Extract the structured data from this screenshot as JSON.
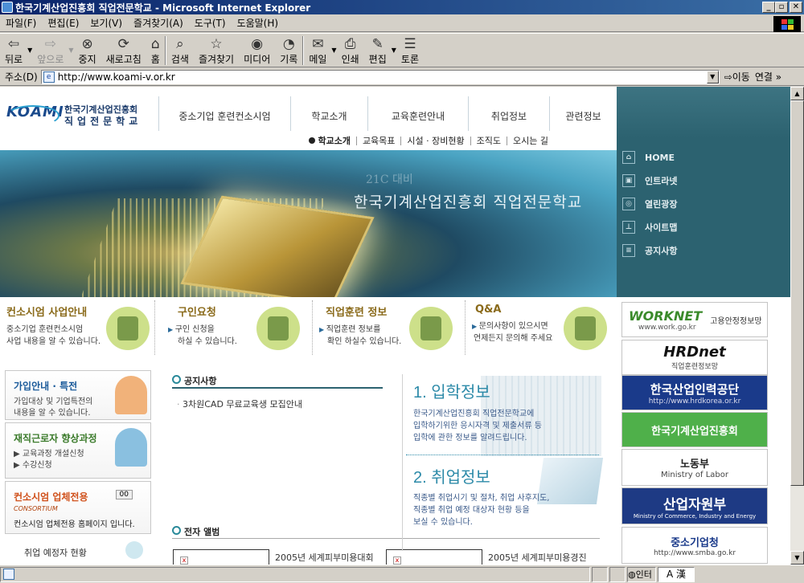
{
  "window": {
    "title": "한국기계산업진흥회 직업전문학교 - Microsoft Internet Explorer",
    "min": "_",
    "max": "▫",
    "close": "✕"
  },
  "menu": [
    "파일(F)",
    "편집(E)",
    "보기(V)",
    "즐겨찾기(A)",
    "도구(T)",
    "도움말(H)"
  ],
  "toolbar": {
    "back": "뒤로",
    "forward": "앞으로",
    "stop": "중지",
    "refresh": "새로고침",
    "home": "홈",
    "search": "검색",
    "favorites": "즐겨찾기",
    "media": "미디어",
    "history": "기록",
    "mail": "메일",
    "print": "인쇄",
    "edit": "편집",
    "discuss": "토론"
  },
  "address": {
    "label": "주소(D)",
    "url": "http://www.koami-v.or.kr",
    "go": "이동",
    "links": "연결 »"
  },
  "site": {
    "logo_mark": "KOAMI",
    "logo_line1": "한국기계산업진흥회",
    "logo_line2": "직업전문학교",
    "gnb": [
      "중소기업 훈련컨소시엄",
      "학교소개",
      "교육훈련안내",
      "취업정보",
      "관련정보"
    ],
    "subnav": [
      "학교소개",
      "교육목표",
      "시설 · 장비현황",
      "조직도",
      "오시는 길"
    ],
    "hero_small": "21C 대비",
    "hero_title": "한국기계산업진흥회 직업전문학교",
    "quick": [
      "HOME",
      "인트라넷",
      "열린광장",
      "사이트맵",
      "공지사항"
    ],
    "services": [
      {
        "title": "컨소시엄 사업안내",
        "d1": "중소기업 훈련컨소시엄",
        "d2": "사업 내용을 알 수 있습니다."
      },
      {
        "title": "구인요청",
        "d1": "구인 신청을",
        "d2": "하실 수 있습니다."
      },
      {
        "title": "직업훈련 정보",
        "d1": "직업훈련 정보를",
        "d2": "확인 하실수 있습니다."
      },
      {
        "title": "Q&A",
        "d1": "문의사항이 있으시면",
        "d2": "언제든지 문의해 주세요"
      }
    ],
    "left": [
      {
        "title": "가입안내 · 특전",
        "d1": "가입대상 및 기업특전의",
        "d2": "내용을 알 수 있습니다."
      },
      {
        "title": "재직근로자 향상과정",
        "d1": "교육과정 개설신청",
        "d2": "수강신청"
      },
      {
        "title": "컨소시엄 업체전용",
        "sub": "CONSORTIUM",
        "badge": "00",
        "d1": "컨소시엄 업체전용 홈페이지 입니다."
      }
    ],
    "employ_status": "취업 예정자 현황",
    "notice_title": "공지사항",
    "notice_items": [
      "3차원CAD 무료교육생 모집안내"
    ],
    "album_title": "전자 앨범",
    "album_items": [
      "2005년 세계피부미용대회",
      "2005년 세계피부미용경진"
    ],
    "info1": {
      "heading": "1. 입학정보",
      "l1": "한국기계산업진흥회 직업전문학교에",
      "l2": "입학하기위한 응시자격 및 제출서류 등",
      "l3": "입학에 관한 정보를 알려드립니다."
    },
    "info2": {
      "heading": "2. 취업정보",
      "l1": "직종별 취업시기 및 절차, 취업 사후지도,",
      "l2": "직종별 취업 예정 대상자 현황 등을",
      "l3": "보실 수 있습니다."
    },
    "banners": [
      {
        "name": "WORKNET",
        "sub": "www.work.go.kr",
        "tag": "고용안정정보망"
      },
      {
        "name": "HRDnet",
        "sub": "직업훈련정보망"
      },
      {
        "name": "한국산업인력공단",
        "sub": "http://www.hrdkorea.or.kr"
      },
      {
        "name": "한국기계산업진흥회"
      },
      {
        "name": "노동부",
        "sub": "Ministry of Labor"
      },
      {
        "name": "산업자원부",
        "sub": "Ministry of Commerce, Industry and Energy"
      },
      {
        "name": "중소기업청",
        "sub": "http://www.smba.go.kr"
      }
    ]
  },
  "status": {
    "zone": "인터",
    "ime": "A 漢"
  }
}
